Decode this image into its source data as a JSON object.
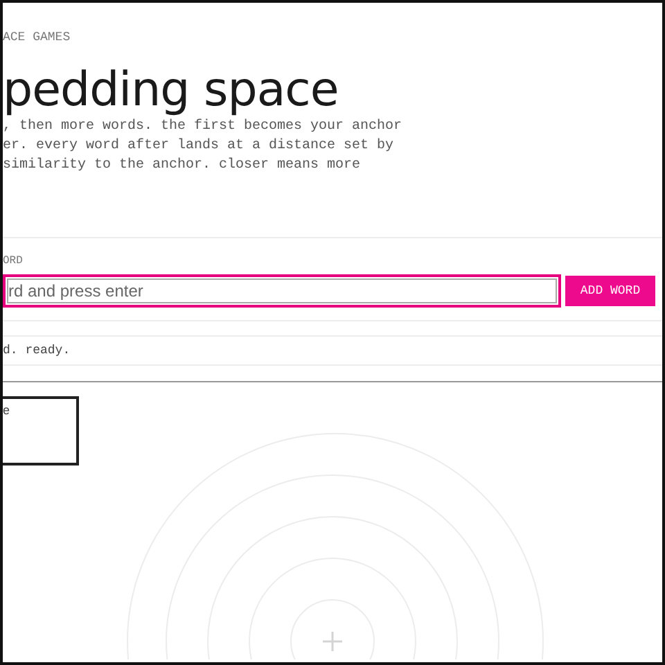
{
  "header": {
    "eyebrow": "ACE GAMES",
    "title": "pedding space",
    "description_lines": [
      ", then more words. the first becomes your anchor",
      "er. every word after lands at a distance set by",
      "similarity to the anchor. closer means more"
    ]
  },
  "form": {
    "label": "ORD",
    "placeholder": "rd and press enter",
    "button": "ADD WORD"
  },
  "status": "d. ready.",
  "card": {
    "text": "e"
  }
}
